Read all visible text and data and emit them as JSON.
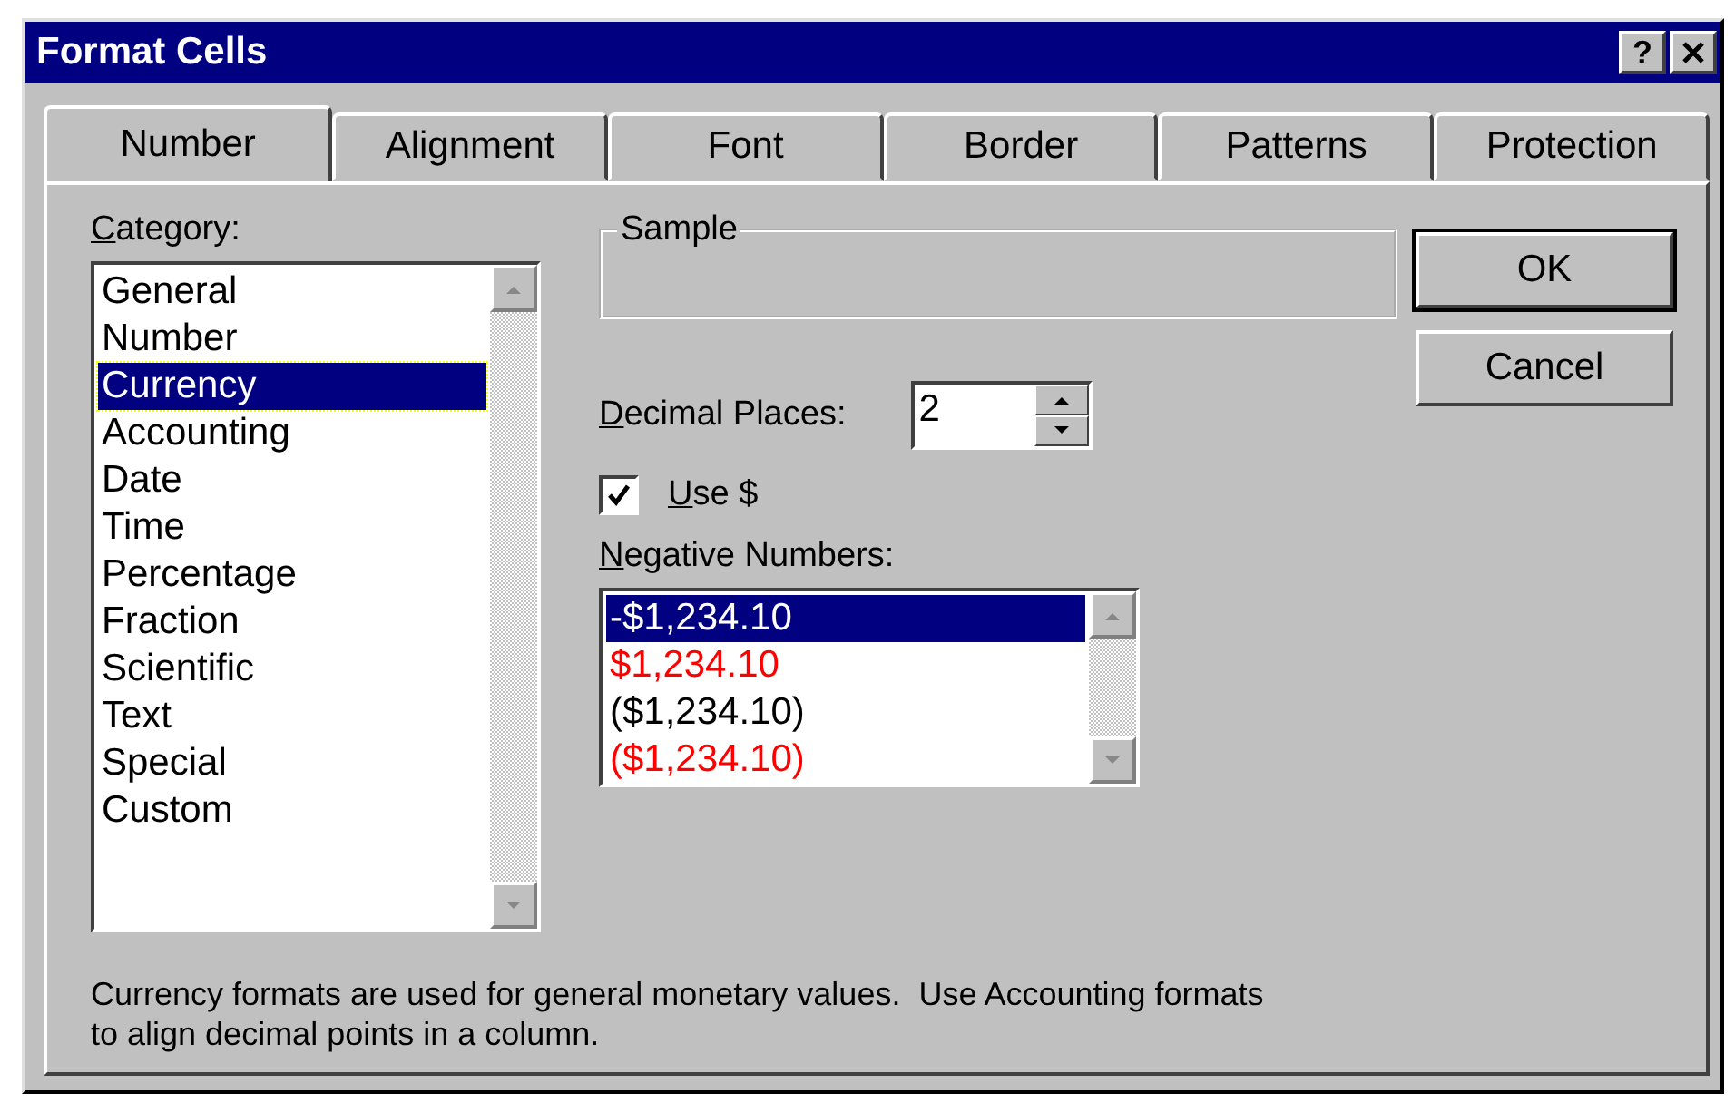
{
  "window": {
    "title": "Format Cells",
    "help_button": "?"
  },
  "tabs": [
    {
      "label": "Number",
      "selected": true
    },
    {
      "label": "Alignment",
      "selected": false
    },
    {
      "label": "Font",
      "selected": false
    },
    {
      "label": "Border",
      "selected": false
    },
    {
      "label": "Patterns",
      "selected": false
    },
    {
      "label": "Protection",
      "selected": false
    }
  ],
  "category": {
    "label": "Category:",
    "items": [
      {
        "label": "General",
        "selected": false
      },
      {
        "label": "Number",
        "selected": false
      },
      {
        "label": "Currency",
        "selected": true
      },
      {
        "label": "Accounting",
        "selected": false
      },
      {
        "label": "Date",
        "selected": false
      },
      {
        "label": "Time",
        "selected": false
      },
      {
        "label": "Percentage",
        "selected": false
      },
      {
        "label": "Fraction",
        "selected": false
      },
      {
        "label": "Scientific",
        "selected": false
      },
      {
        "label": "Text",
        "selected": false
      },
      {
        "label": "Special",
        "selected": false
      },
      {
        "label": "Custom",
        "selected": false
      }
    ]
  },
  "sample": {
    "label": "Sample"
  },
  "decimal_places": {
    "label": "Decimal Places:",
    "value": "2"
  },
  "use_symbol": {
    "label": "Use $",
    "checked": true
  },
  "negative_numbers": {
    "label": "Negative Numbers:",
    "items": [
      {
        "label": "-$1,234.10",
        "selected": true
      },
      {
        "label": "$1,234.10",
        "color": "#ff0000",
        "selected": false
      },
      {
        "label": "($1,234.10)",
        "color": "#000000",
        "selected": false
      },
      {
        "label": "($1,234.10)",
        "color": "#ff0000",
        "selected": false
      }
    ]
  },
  "buttons": [
    "OK",
    "Cancel"
  ],
  "description": "Currency formats are used for general monetary values.  Use Accounting formats to align decimal points in a column."
}
